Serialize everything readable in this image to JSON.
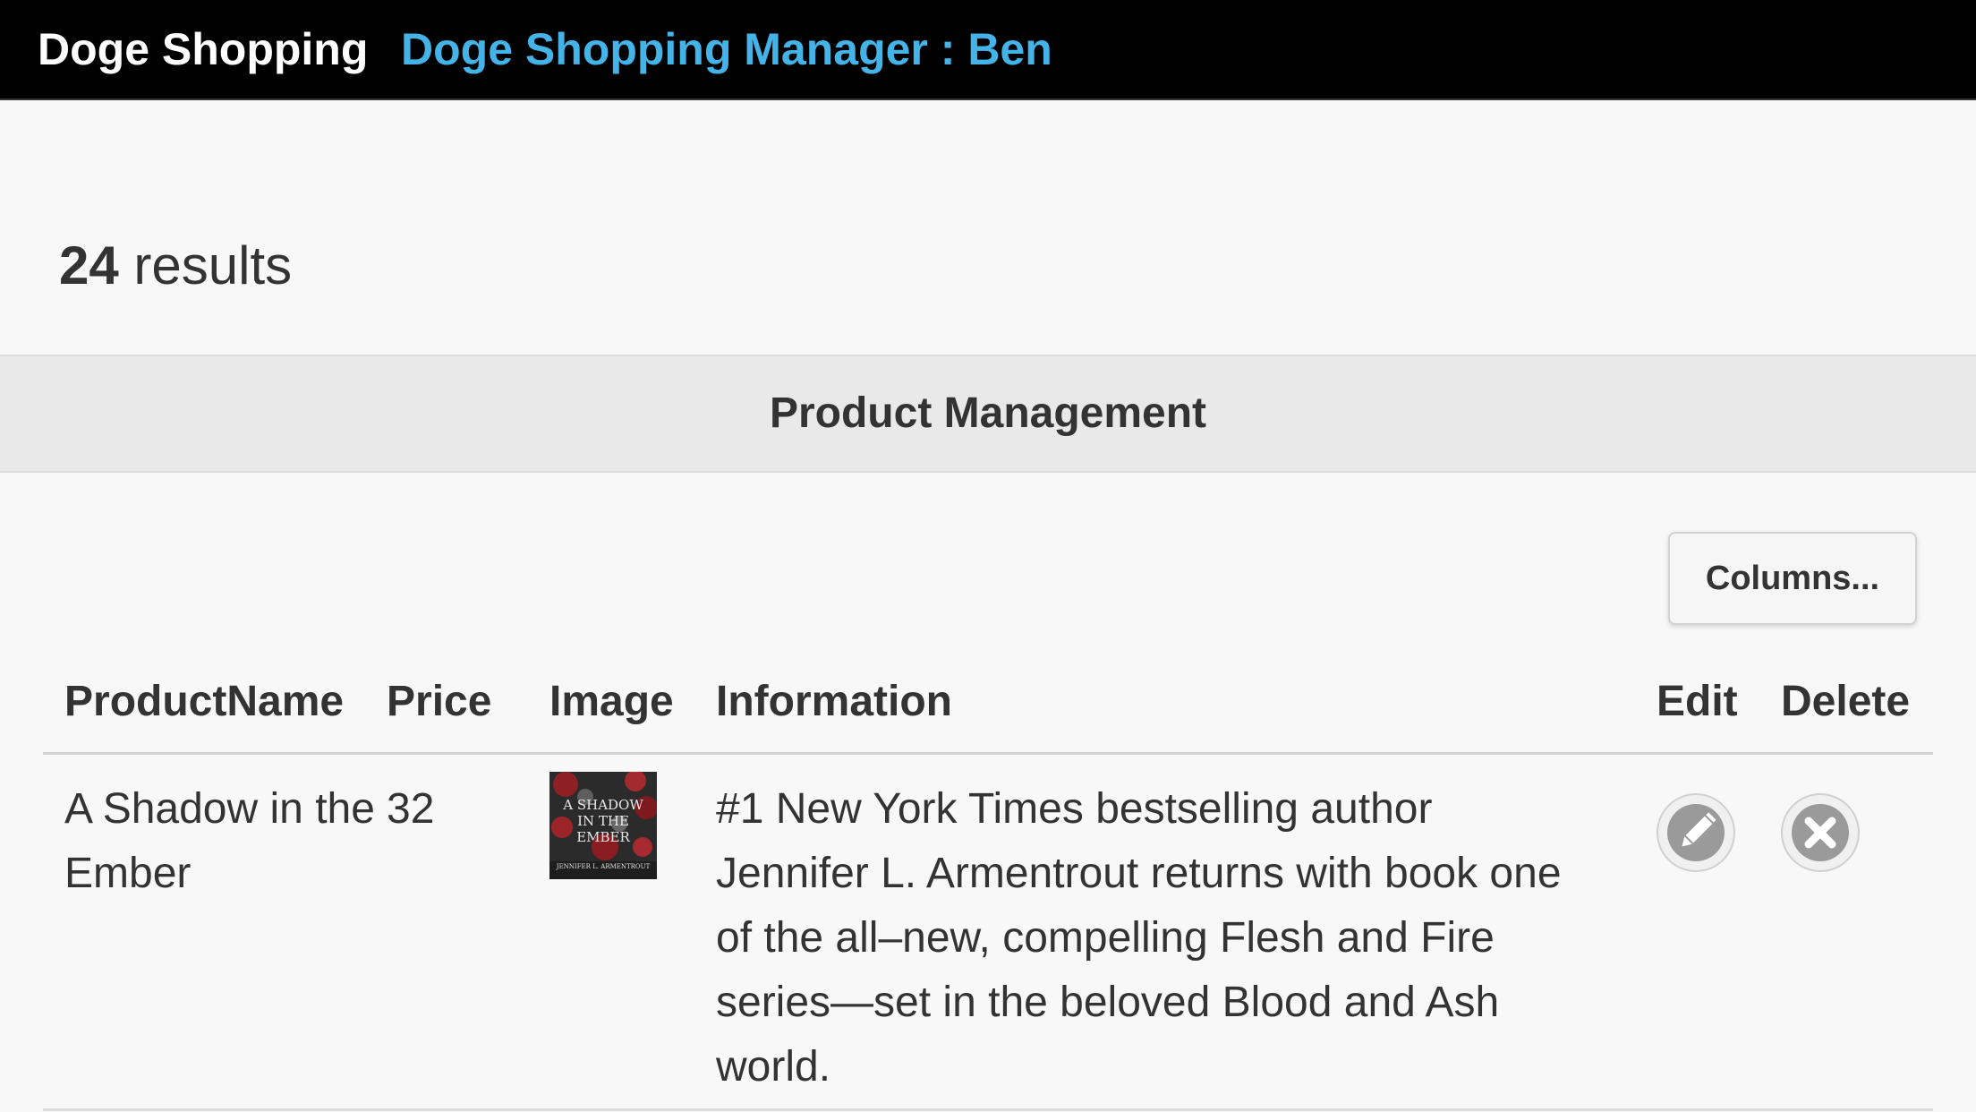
{
  "header": {
    "brand": "Doge Shopping",
    "manager_label": "Doge Shopping Manager : Ben"
  },
  "results": {
    "count": "24",
    "label": " results"
  },
  "section": {
    "title": "Product Management"
  },
  "toolbar": {
    "columns_label": "Columns..."
  },
  "table": {
    "columns": [
      "ProductName",
      "Price",
      "Image",
      "Information",
      "Edit",
      "Delete"
    ],
    "rows": [
      {
        "product_name": "A Shadow in the Ember",
        "price": "32",
        "image_text": {
          "top": "A SHADOW IN THE EMBER",
          "author": "JENNIFER L. ARMENTROUT"
        },
        "information": "#1 New York Times bestselling author Jennifer L. Armentrout returns with book one of the all–new, compelling Flesh and Fire series—set in the beloved Blood and Ash world.",
        "edit_icon": "pencil-icon",
        "delete_icon": "close-icon"
      }
    ]
  },
  "colors": {
    "topbar_bg": "#000000",
    "brand": "#ffffff",
    "manager": "#44b3e8",
    "page_bg": "#f8f8f8",
    "section_bg": "#e9e9e9",
    "icon_fill": "#9a9a9a"
  }
}
